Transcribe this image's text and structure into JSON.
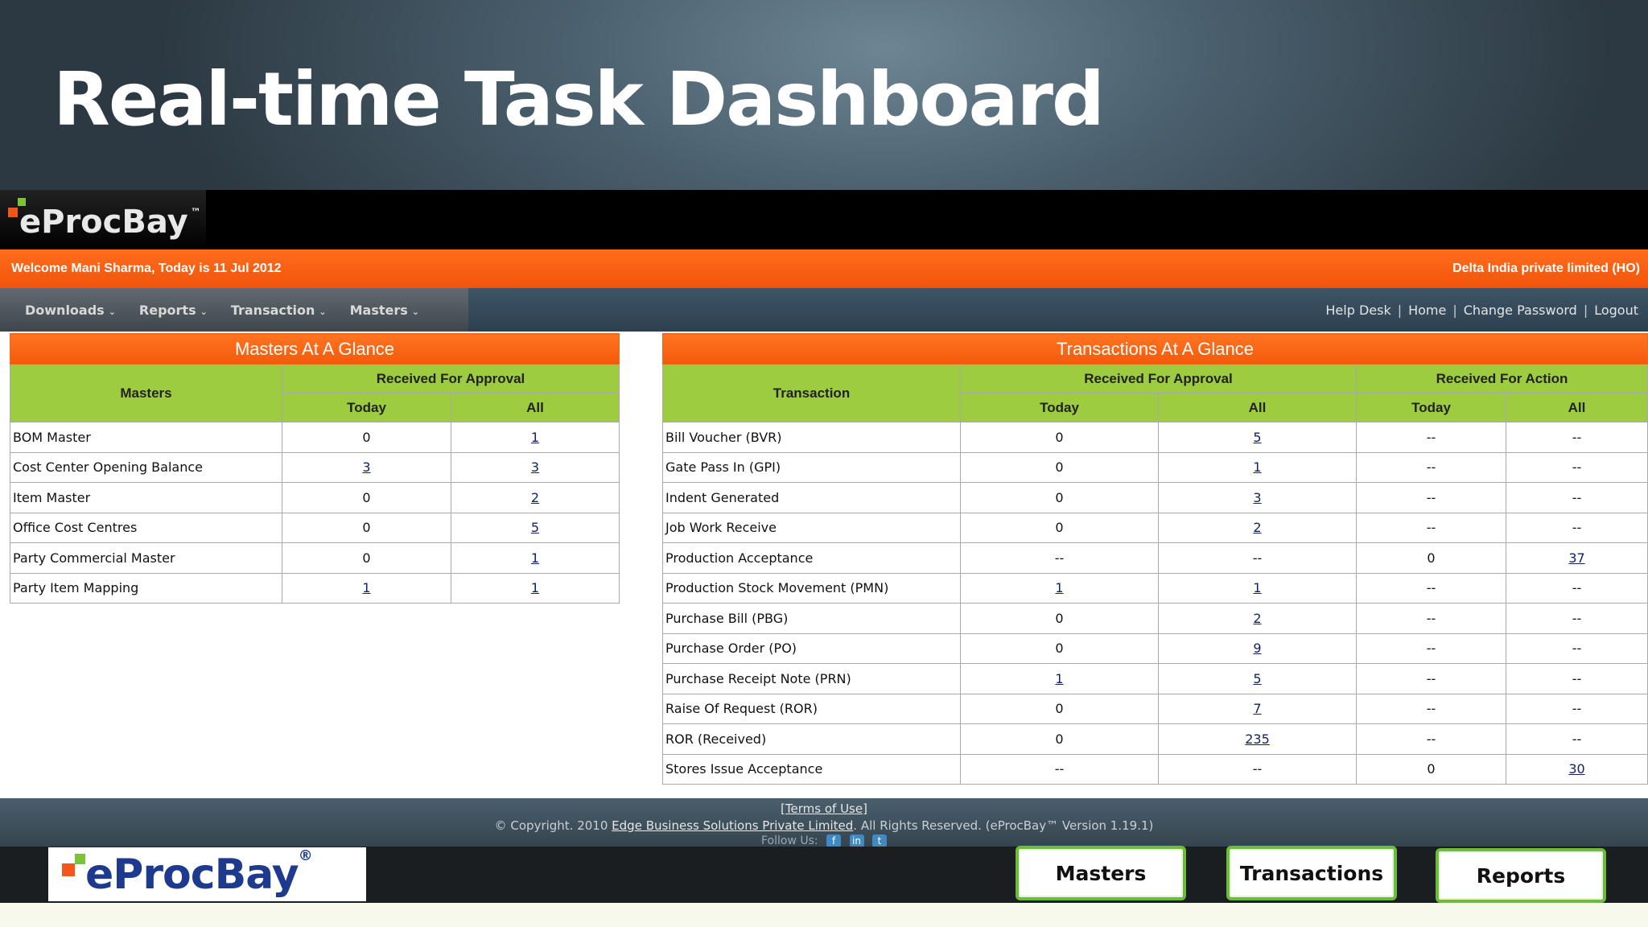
{
  "slide": {
    "title": "Real-time Task Dashboard"
  },
  "app": {
    "brand": "eProcBay",
    "trademark": "™"
  },
  "welcome": {
    "left": "Welcome Mani Sharma, Today is 11 Jul 2012",
    "right": "Delta India private limited (HO)"
  },
  "nav": {
    "menu": [
      {
        "label": "Downloads"
      },
      {
        "label": "Reports"
      },
      {
        "label": "Transaction"
      },
      {
        "label": "Masters"
      }
    ],
    "links": [
      "Help Desk",
      "Home",
      "Change Password",
      "Logout"
    ],
    "separator": "|"
  },
  "masters_table": {
    "caption": "Masters At A Glance",
    "col_name": "Masters",
    "group": "Received For Approval",
    "sub_today": "Today",
    "sub_all": "All",
    "rows": [
      {
        "name": "BOM Master",
        "today": "0",
        "all": "1"
      },
      {
        "name": "Cost Center Opening Balance",
        "today": "3",
        "all": "3"
      },
      {
        "name": "Item Master",
        "today": "0",
        "all": "2"
      },
      {
        "name": "Office Cost Centres",
        "today": "0",
        "all": "5"
      },
      {
        "name": "Party Commercial Master",
        "today": "0",
        "all": "1"
      },
      {
        "name": "Party Item Mapping",
        "today": "1",
        "all": "1"
      }
    ]
  },
  "transactions_table": {
    "caption": "Transactions At A Glance",
    "col_name": "Transaction",
    "group_approval": "Received For Approval",
    "group_action": "Received For Action",
    "sub_today": "Today",
    "sub_all": "All",
    "rows": [
      {
        "name": "Bill Voucher (BVR)",
        "ap_today": "0",
        "ap_all": "5",
        "ac_today": "--",
        "ac_all": "--"
      },
      {
        "name": "Gate Pass In (GPI)",
        "ap_today": "0",
        "ap_all": "1",
        "ac_today": "--",
        "ac_all": "--"
      },
      {
        "name": "Indent Generated",
        "ap_today": "0",
        "ap_all": "3",
        "ac_today": "--",
        "ac_all": "--"
      },
      {
        "name": "Job Work Receive",
        "ap_today": "0",
        "ap_all": "2",
        "ac_today": "--",
        "ac_all": "--"
      },
      {
        "name": "Production Acceptance",
        "ap_today": "--",
        "ap_all": "--",
        "ac_today": "0",
        "ac_all": "37"
      },
      {
        "name": "Production Stock Movement (PMN)",
        "ap_today": "1",
        "ap_all": "1",
        "ac_today": "--",
        "ac_all": "--"
      },
      {
        "name": "Purchase Bill (PBG)",
        "ap_today": "0",
        "ap_all": "2",
        "ac_today": "--",
        "ac_all": "--"
      },
      {
        "name": "Purchase Order (PO)",
        "ap_today": "0",
        "ap_all": "9",
        "ac_today": "--",
        "ac_all": "--"
      },
      {
        "name": "Purchase Receipt Note (PRN)",
        "ap_today": "1",
        "ap_all": "5",
        "ac_today": "--",
        "ac_all": "--"
      },
      {
        "name": "Raise Of Request (ROR)",
        "ap_today": "0",
        "ap_all": "7",
        "ac_today": "--",
        "ac_all": "--"
      },
      {
        "name": "ROR (Received)",
        "ap_today": "0",
        "ap_all": "235",
        "ac_today": "--",
        "ac_all": "--"
      },
      {
        "name": "Stores Issue Acceptance",
        "ap_today": "--",
        "ap_all": "--",
        "ac_today": "0",
        "ac_all": "30"
      }
    ]
  },
  "footer": {
    "terms": "[Terms of Use]",
    "copyright_prefix": "© Copyright. 2010 ",
    "company": "Edge Business Solutions Private Limited",
    "copyright_suffix": ". All Rights Reserved. (eProcBay™ Version 1.19.1)",
    "follow": "Follow Us:"
  },
  "bottom": {
    "brand": "eProcBay",
    "registered": "®",
    "buttons": [
      "Masters",
      "Transactions",
      "Reports"
    ]
  },
  "colors": {
    "accent_orange": "#f45a0c",
    "header_green": "#9dcc40",
    "button_border": "#6cbb3c",
    "logo_blue": "#1e3a8f"
  }
}
